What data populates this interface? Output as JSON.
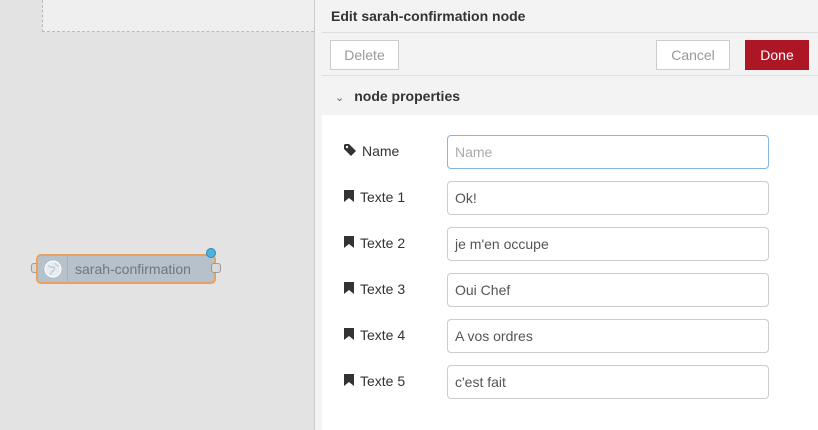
{
  "canvas": {
    "node_label": "sarah-confirmation"
  },
  "tray": {
    "title": "Edit sarah-confirmation node",
    "delete_label": "Delete",
    "cancel_label": "Cancel",
    "done_label": "Done",
    "section_title": "node properties",
    "fields": [
      {
        "label": "Name",
        "value": "",
        "placeholder": "Name",
        "icon": "tag-icon"
      },
      {
        "label": "Texte 1",
        "value": "Ok!",
        "icon": "bookmark-icon"
      },
      {
        "label": "Texte 2",
        "value": "je m'en occupe",
        "icon": "bookmark-icon"
      },
      {
        "label": "Texte 3",
        "value": "Oui Chef",
        "icon": "bookmark-icon"
      },
      {
        "label": "Texte 4",
        "value": "A vos ordres",
        "icon": "bookmark-icon"
      },
      {
        "label": "Texte 5",
        "value": "c'est fait",
        "icon": "bookmark-icon"
      }
    ]
  },
  "colors": {
    "done": "#ad1625",
    "node_border": "#e9a061",
    "node_fill": "#b7c1cc"
  }
}
